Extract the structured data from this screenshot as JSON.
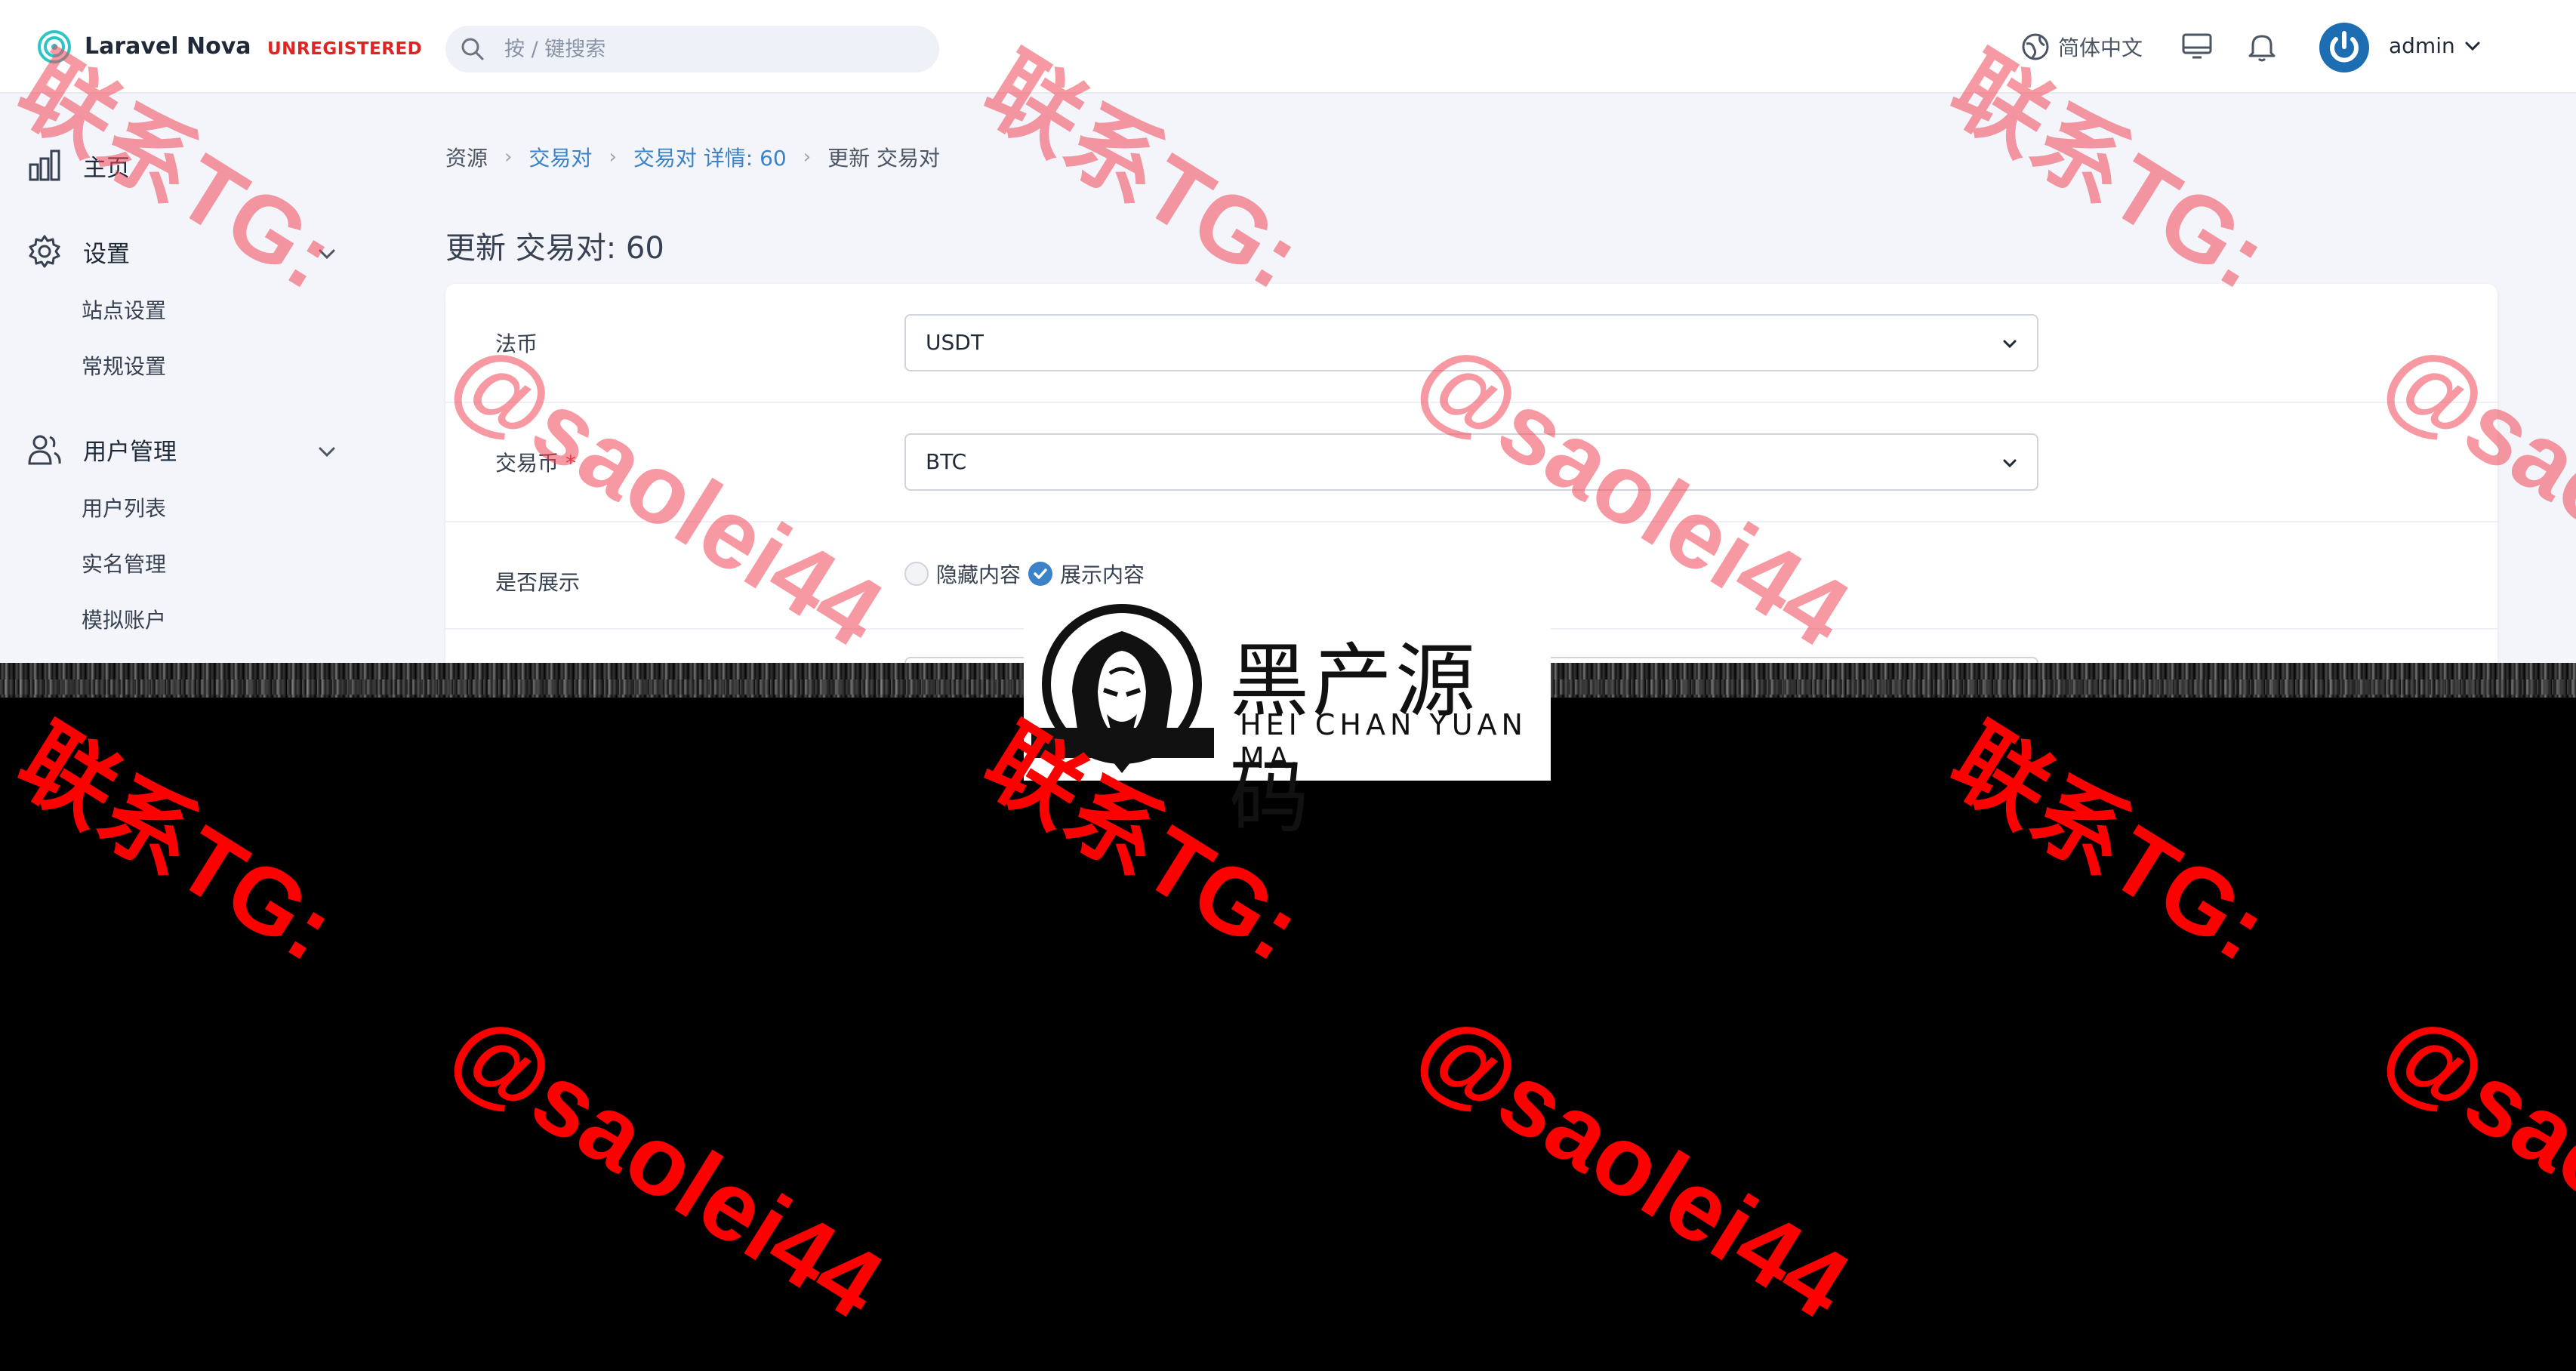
{
  "header": {
    "app_name": "Laravel Nova",
    "license_badge": "UNREGISTERED",
    "search_placeholder": "按 / 键搜索",
    "language": "简体中文",
    "username": "admin"
  },
  "sidebar": {
    "home": "主页",
    "settings": {
      "label": "设置",
      "items": [
        "站点设置",
        "常规设置"
      ]
    },
    "users": {
      "label": "用户管理",
      "items": [
        "用户列表",
        "实名管理",
        "模拟账户"
      ]
    }
  },
  "breadcrumb": [
    "资源",
    "交易对",
    "交易对 详情: 60",
    "更新 交易对"
  ],
  "page_title": "更新 交易对: 60",
  "form": {
    "fiat": {
      "label": "法币",
      "value": "USDT"
    },
    "trade_coin": {
      "label": "交易币",
      "required_mark": "*",
      "value": "BTC"
    },
    "display": {
      "label": "是否展示",
      "option_hide": "隐藏内容",
      "option_show": "展示内容",
      "selected": "展示内容"
    }
  },
  "watermark": {
    "brand_cn": "黑产源码",
    "brand_en": "HEI CHAN YUAN MA",
    "line1": "联系TG:",
    "line2": "@saolei44"
  },
  "colors": {
    "accent": "#3b82c6",
    "danger": "#e02424",
    "watermark_red": "#ff0000"
  }
}
